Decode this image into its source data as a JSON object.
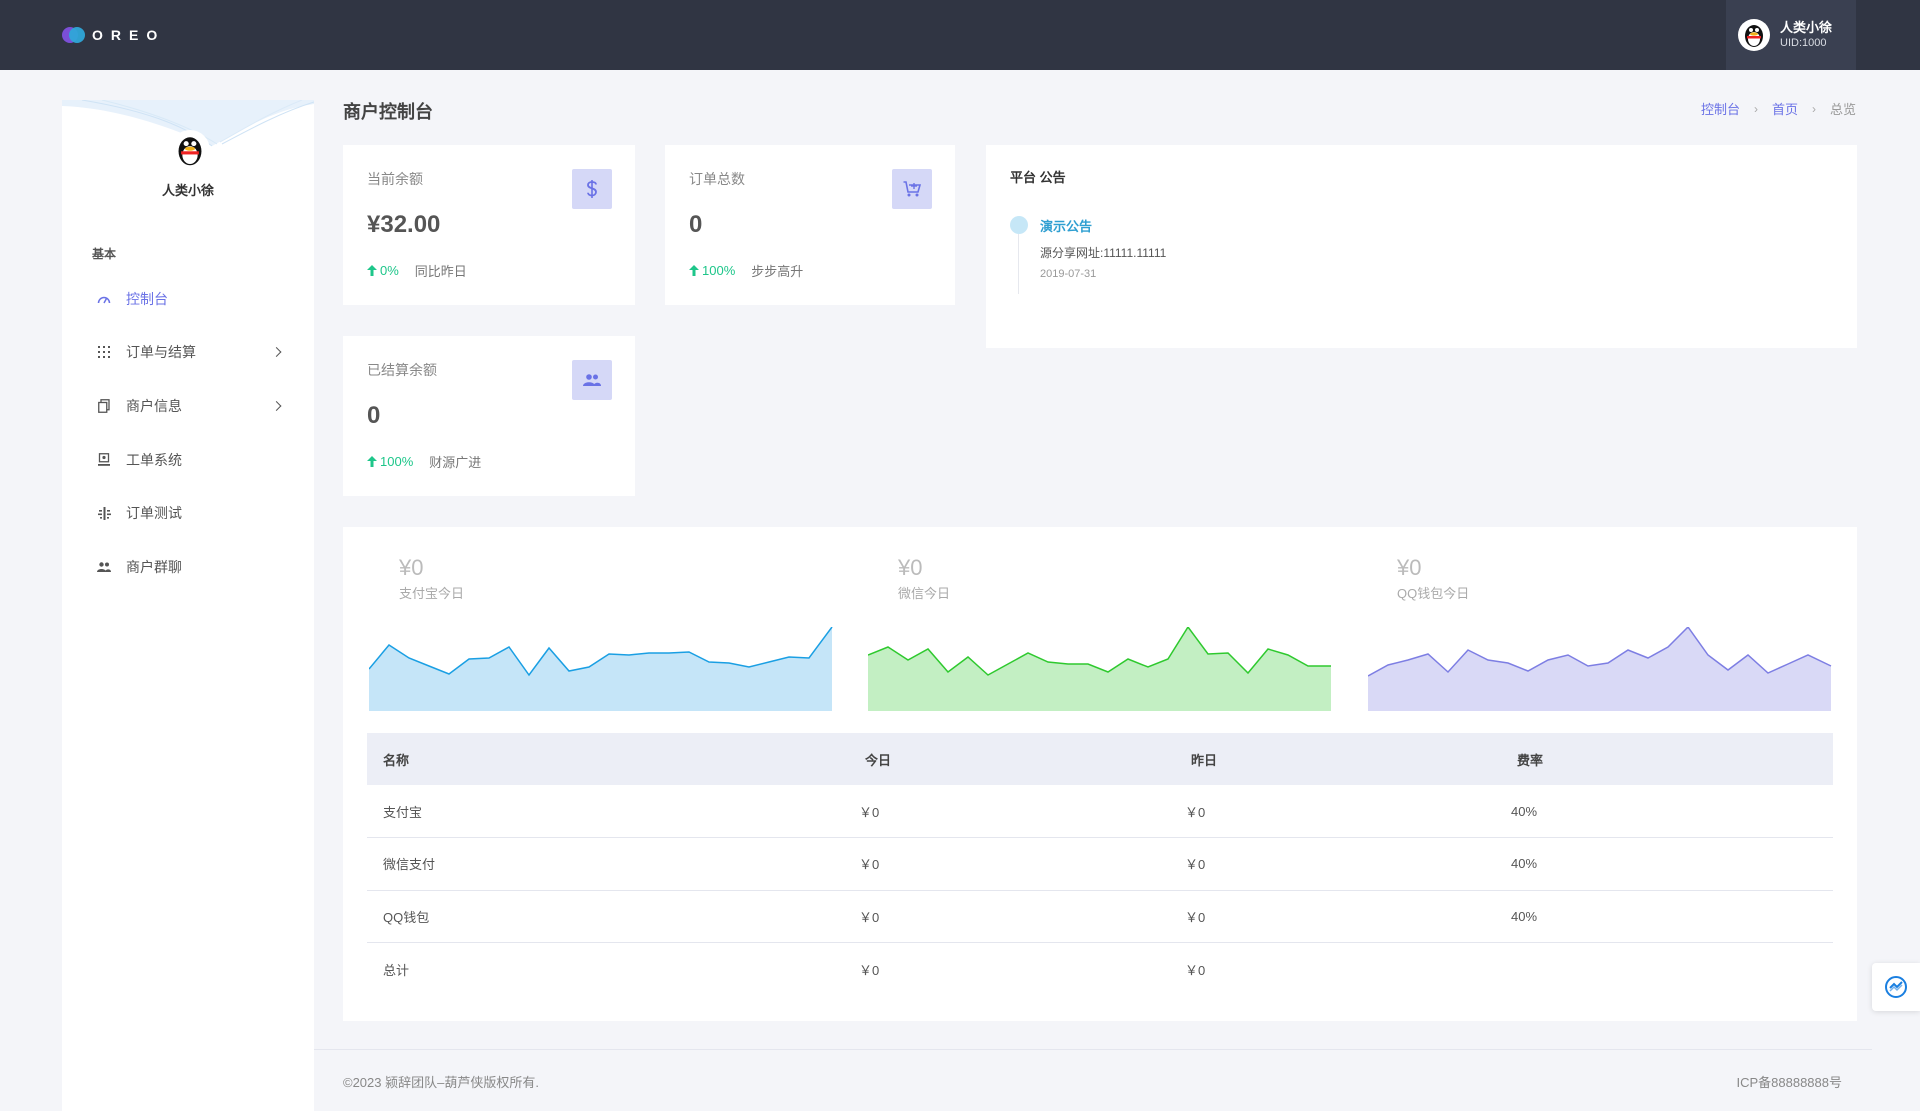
{
  "brand": {
    "name": "OREO"
  },
  "top_user": {
    "name": "人类小徐",
    "uid": "UID:1000",
    "avatar_icon": "qq-penguin-icon"
  },
  "sidebar": {
    "user_name": "人类小徐",
    "section_label": "基本",
    "items": [
      {
        "label": "控制台",
        "icon": "dashboard-gauge-icon",
        "active": true,
        "has_submenu": false
      },
      {
        "label": "订单与结算",
        "icon": "grid-dots-icon",
        "active": false,
        "has_submenu": true
      },
      {
        "label": "商户信息",
        "icon": "documents-icon",
        "active": false,
        "has_submenu": true
      },
      {
        "label": "工单系统",
        "icon": "ticket-icon",
        "active": false,
        "has_submenu": false
      },
      {
        "label": "订单测试",
        "icon": "test-icon",
        "active": false,
        "has_submenu": false
      },
      {
        "label": "商户群聊",
        "icon": "group-chat-icon",
        "active": false,
        "has_submenu": false
      }
    ]
  },
  "page": {
    "title": "商户控制台",
    "breadcrumb": [
      "控制台",
      "首页",
      "总览"
    ]
  },
  "stats": {
    "balance": {
      "label": "当前余额",
      "value": "¥32.00",
      "trend": "0%",
      "note": "同比昨日",
      "icon": "dollar-icon"
    },
    "orders": {
      "label": "订单总数",
      "value": "0",
      "trend": "100%",
      "note": "步步高升",
      "icon": "cart-icon"
    },
    "settled": {
      "label": "已结算余额",
      "value": "0",
      "trend": "100%",
      "note": "财源广进",
      "icon": "users-icon"
    }
  },
  "notice": {
    "title": "平台 公告",
    "items": [
      {
        "title": "演示公告",
        "text": "源分享网址:11111.11111",
        "date": "2019-07-31"
      }
    ]
  },
  "sparklines": [
    {
      "amount": "¥0",
      "label": "支付宝今日",
      "color": "#1a9fe3",
      "fill": "#c5e5f8"
    },
    {
      "amount": "¥0",
      "label": "微信今日",
      "color": "#2ec92e",
      "fill": "#c3efc3"
    },
    {
      "amount": "¥0",
      "label": "QQ钱包今日",
      "color": "#7d7ee3",
      "fill": "#d9d9f6"
    }
  ],
  "revenue_table": {
    "headers": [
      "名称",
      "今日",
      "昨日",
      "费率"
    ],
    "rows": [
      [
        "支付宝",
        "￥0",
        "￥0",
        "40%"
      ],
      [
        "微信支付",
        "￥0",
        "￥0",
        "40%"
      ],
      [
        "QQ钱包",
        "￥0",
        "￥0",
        "40%"
      ],
      [
        "总计",
        "￥0",
        "￥0",
        ""
      ]
    ]
  },
  "footer": {
    "copyright": "©2023 颍辞团队–葫芦侠版权所有.",
    "icp": "ICP备88888888号"
  }
}
